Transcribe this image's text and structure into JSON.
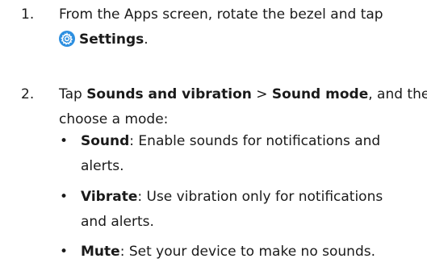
{
  "steps": [
    {
      "number": "1.",
      "line1": "From the Apps screen, rotate the bezel and tap",
      "icon": "settings-gear-icon",
      "bold": "Settings",
      "suffix": "."
    },
    {
      "number": "2.",
      "prefix": "Tap ",
      "bold1": "Sounds and vibration",
      "separator": " > ",
      "bold2": "Sound mode",
      "suffix": ", and then",
      "line2": "choose a mode:"
    }
  ],
  "bullets": [
    {
      "marker": "•",
      "term": "Sound",
      "line1": ": Enable sounds for notifications and",
      "line2": "alerts."
    },
    {
      "marker": "•",
      "term": "Vibrate",
      "line1": ": Use vibration only for notifications",
      "line2": "and alerts."
    },
    {
      "marker": "•",
      "term": "Mute",
      "line1": ": Set your device to make no sounds."
    }
  ],
  "colors": {
    "text": "#1a1a1a",
    "icon_bg": "#2d8fe0"
  }
}
